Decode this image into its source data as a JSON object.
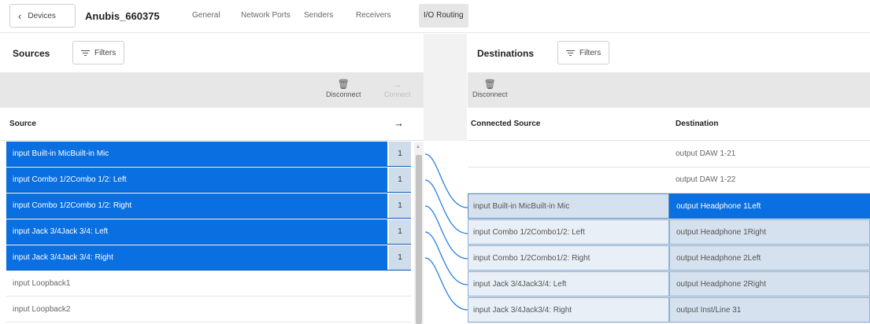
{
  "nav": {
    "back_label": "Devices",
    "device_name": "Anubis_660375",
    "tabs": [
      "General",
      "Network Ports",
      "Senders",
      "Receivers",
      "I/O Routing"
    ],
    "active_tab": "I/O Routing"
  },
  "sources": {
    "title": "Sources",
    "filters_label": "Filters",
    "toolbar": {
      "disconnect_label": "Disconnect",
      "connect_label": "Connect"
    },
    "column_header": "Source",
    "rows": [
      {
        "name": "input Built-in MicBuilt-in Mic",
        "count": "1",
        "selected": true
      },
      {
        "name": "input Combo 1/2Combo 1/2: Left",
        "count": "1",
        "selected": true
      },
      {
        "name": "input Combo 1/2Combo 1/2: Right",
        "count": "1",
        "selected": true
      },
      {
        "name": "input Jack 3/4Jack 3/4: Left",
        "count": "1",
        "selected": true
      },
      {
        "name": "input Jack 3/4Jack 3/4: Right",
        "count": "1",
        "selected": true
      },
      {
        "name": "input Loopback1",
        "count": "",
        "selected": false
      },
      {
        "name": "input Loopback2",
        "count": "",
        "selected": false
      }
    ]
  },
  "destinations": {
    "title": "Destinations",
    "filters_label": "Filters",
    "toolbar": {
      "disconnect_label": "Disconnect"
    },
    "column_connected": "Connected Source",
    "column_destination": "Destination",
    "rows": [
      {
        "connected": "",
        "destination": "output DAW 1-21"
      },
      {
        "connected": "",
        "destination": "output DAW 1-22"
      },
      {
        "connected": "input Built-in MicBuilt-in Mic",
        "destination": "output Headphone 1Left",
        "selected": true
      },
      {
        "connected": "input Combo 1/2Combo1/2: Left",
        "destination": "output Headphone 1Right"
      },
      {
        "connected": "input Combo 1/2Combo1/2: Right",
        "destination": "output Headphone 2Left"
      },
      {
        "connected": "input Jack 3/4Jack3/4: Left",
        "destination": "output Headphone 2Right"
      },
      {
        "connected": "input Jack 3/4Jack3/4: Right",
        "destination": "output Inst/Line 31"
      }
    ]
  },
  "colors": {
    "selected": "#0a6fe0",
    "wire": "#2a7fe0",
    "toolbar_bg": "#e7e7e7"
  }
}
